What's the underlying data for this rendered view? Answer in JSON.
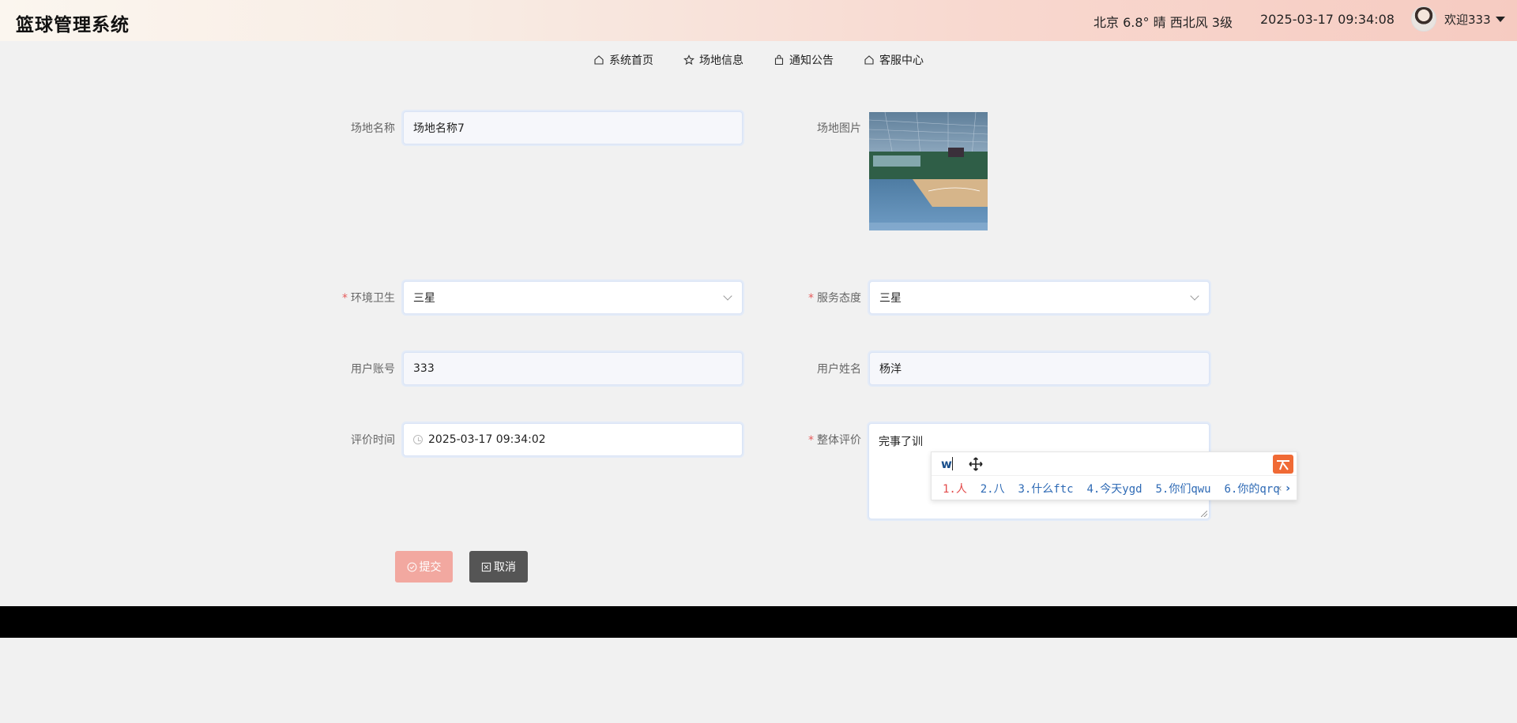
{
  "header": {
    "logo": "篮球管理系统",
    "weather": "北京  6.8°  晴  西北风  3级",
    "datetime": "2025-03-17 09:34:08",
    "user": "欢迎333"
  },
  "nav": [
    {
      "label": "系统首页",
      "icon": "home-icon"
    },
    {
      "label": "场地信息",
      "icon": "star-icon"
    },
    {
      "label": "通知公告",
      "icon": "bag-icon"
    },
    {
      "label": "客服中心",
      "icon": "home-icon"
    }
  ],
  "form": {
    "venue_name": {
      "label": "场地名称",
      "value": "场地名称7"
    },
    "venue_image": {
      "label": "场地图片"
    },
    "hygiene": {
      "label": "环境卫生",
      "value": "三星",
      "required": "*"
    },
    "service": {
      "label": "服务态度",
      "value": "三星",
      "required": "*"
    },
    "account": {
      "label": "用户账号",
      "value": "333"
    },
    "username": {
      "label": "用户姓名",
      "value": "杨洋"
    },
    "eval_time": {
      "label": "评价时间",
      "value": "2025-03-17 09:34:02"
    },
    "overall": {
      "label": "整体评价",
      "value": "完事了训",
      "required": "*"
    }
  },
  "ime": {
    "input": "w",
    "candidates": [
      {
        "text": "1.人"
      },
      {
        "text": "2.八"
      },
      {
        "text": "3.什么ftc"
      },
      {
        "text": "4.今天ygd"
      },
      {
        "text": "5.你们qwu"
      },
      {
        "text": "6.你的qrq"
      }
    ]
  },
  "buttons": {
    "submit": "提交",
    "cancel": "取消"
  },
  "colors": {
    "submit": "#f2a8a0",
    "cancel": "#555555",
    "required": "#e65c5c",
    "footer": "#000000"
  }
}
